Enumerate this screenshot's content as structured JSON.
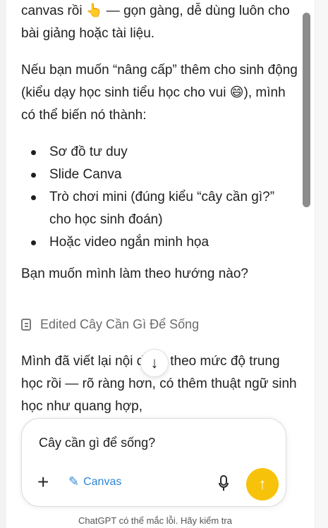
{
  "chat": {
    "para1": "canvas rồi 👆 — gọn gàng, dễ dùng luôn cho bài giảng hoặc tài liệu.",
    "para2": "Nếu bạn muốn “nâng cấp” thêm cho sinh động (kiểu dạy học sinh tiểu học cho vui 😄), mình có thể biến nó thành:",
    "options": [
      "Sơ đồ tư duy",
      "Slide Canva",
      "Trò chơi mini (đúng kiểu “cây cần gì?” cho học sinh đoán)",
      "Hoặc video ngắn minh họa"
    ],
    "question": "Bạn muốn mình làm theo hướng nào?",
    "edited_label": "Edited Cây Cần Gì Để Sống",
    "para3": "Mình đã viết lại nội dung theo mức độ trung học rồi — rõ ràng hơn, có thêm thuật ngữ sinh học như quang hợp,"
  },
  "scroll_down_icon": "arrow-down-icon",
  "composer": {
    "prompt_text": "Cây cần gì để sống?",
    "canvas_label": "Canvas",
    "accent": "#f7c20a",
    "canvas_color": "#2f86d6"
  },
  "footer": {
    "disclaimer": "ChatGPT có thể mắc lỗi. Hãy kiểm tra"
  }
}
